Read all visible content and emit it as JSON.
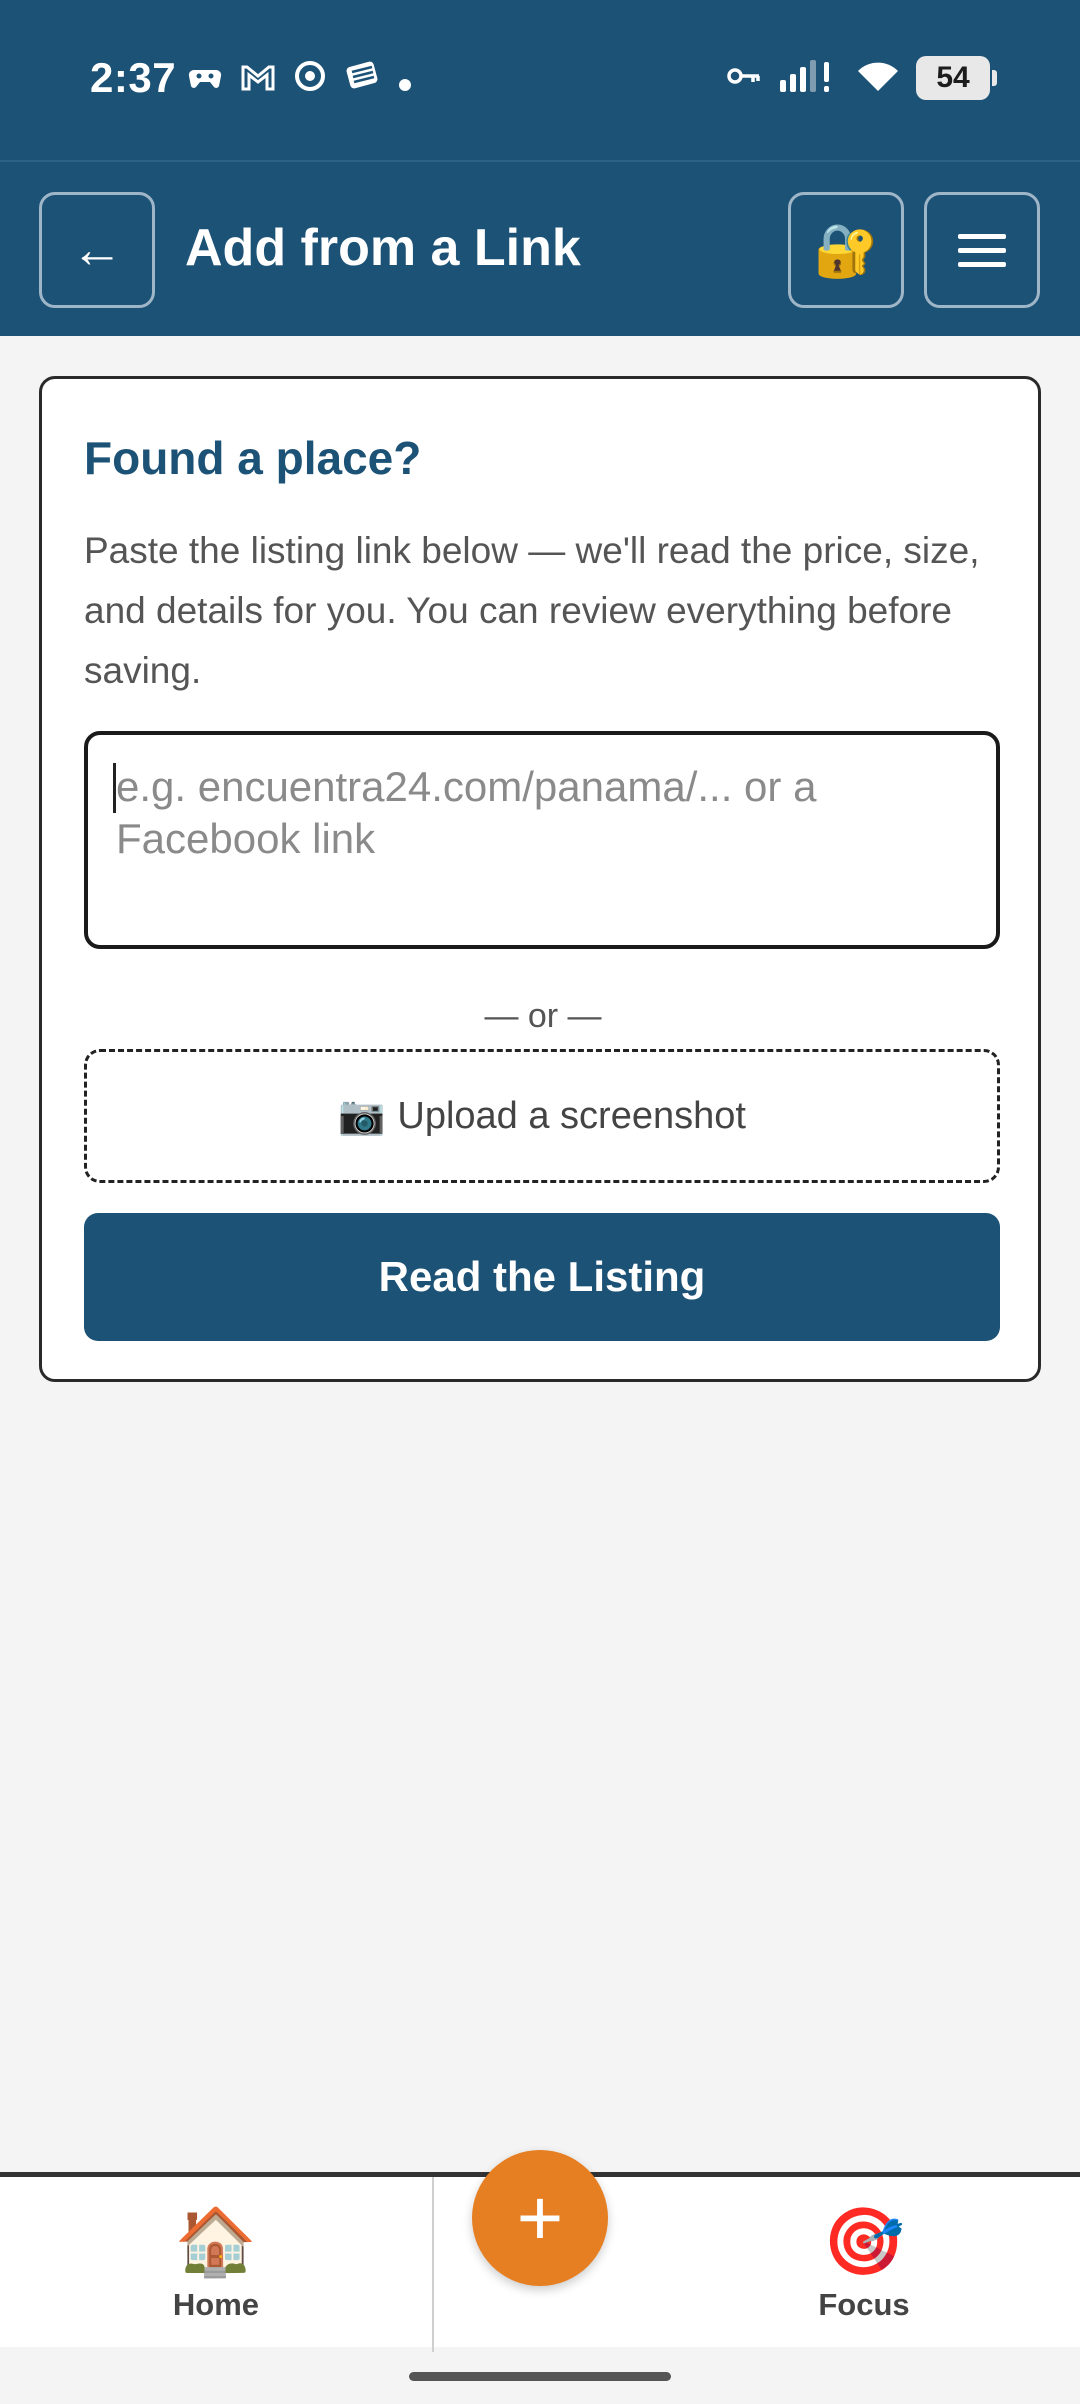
{
  "status_bar": {
    "time": "2:37",
    "left_icons": [
      "game-controller-icon",
      "gmail-icon",
      "chrome-icon",
      "stack-icon",
      "dot-icon"
    ],
    "right_icons": [
      "vpn-key-icon",
      "signal-icon",
      "wifi-icon"
    ],
    "battery": "54"
  },
  "header": {
    "title": "Add from a Link",
    "back_symbol": "←",
    "lock_symbol": "🔐"
  },
  "card": {
    "title": "Found a place?",
    "description": "Paste the listing link below — we'll read the price, size, and details for you. You can review everything before saving.",
    "input_placeholder": "e.g. encuentra24.com/panama/... or a Facebook link",
    "input_value": "",
    "or_separator": "— or —",
    "upload_icon": "📷",
    "upload_label": "Upload a screenshot",
    "read_button_label": "Read the Listing"
  },
  "bottom_nav": {
    "home": {
      "icon": "🏠",
      "label": "Home"
    },
    "add": {
      "icon": "+"
    },
    "focus": {
      "icon": "🎯",
      "label": "Focus"
    }
  },
  "colors": {
    "primary": "#1c5276",
    "accent": "#e67e22",
    "background": "#f4f4f4"
  }
}
